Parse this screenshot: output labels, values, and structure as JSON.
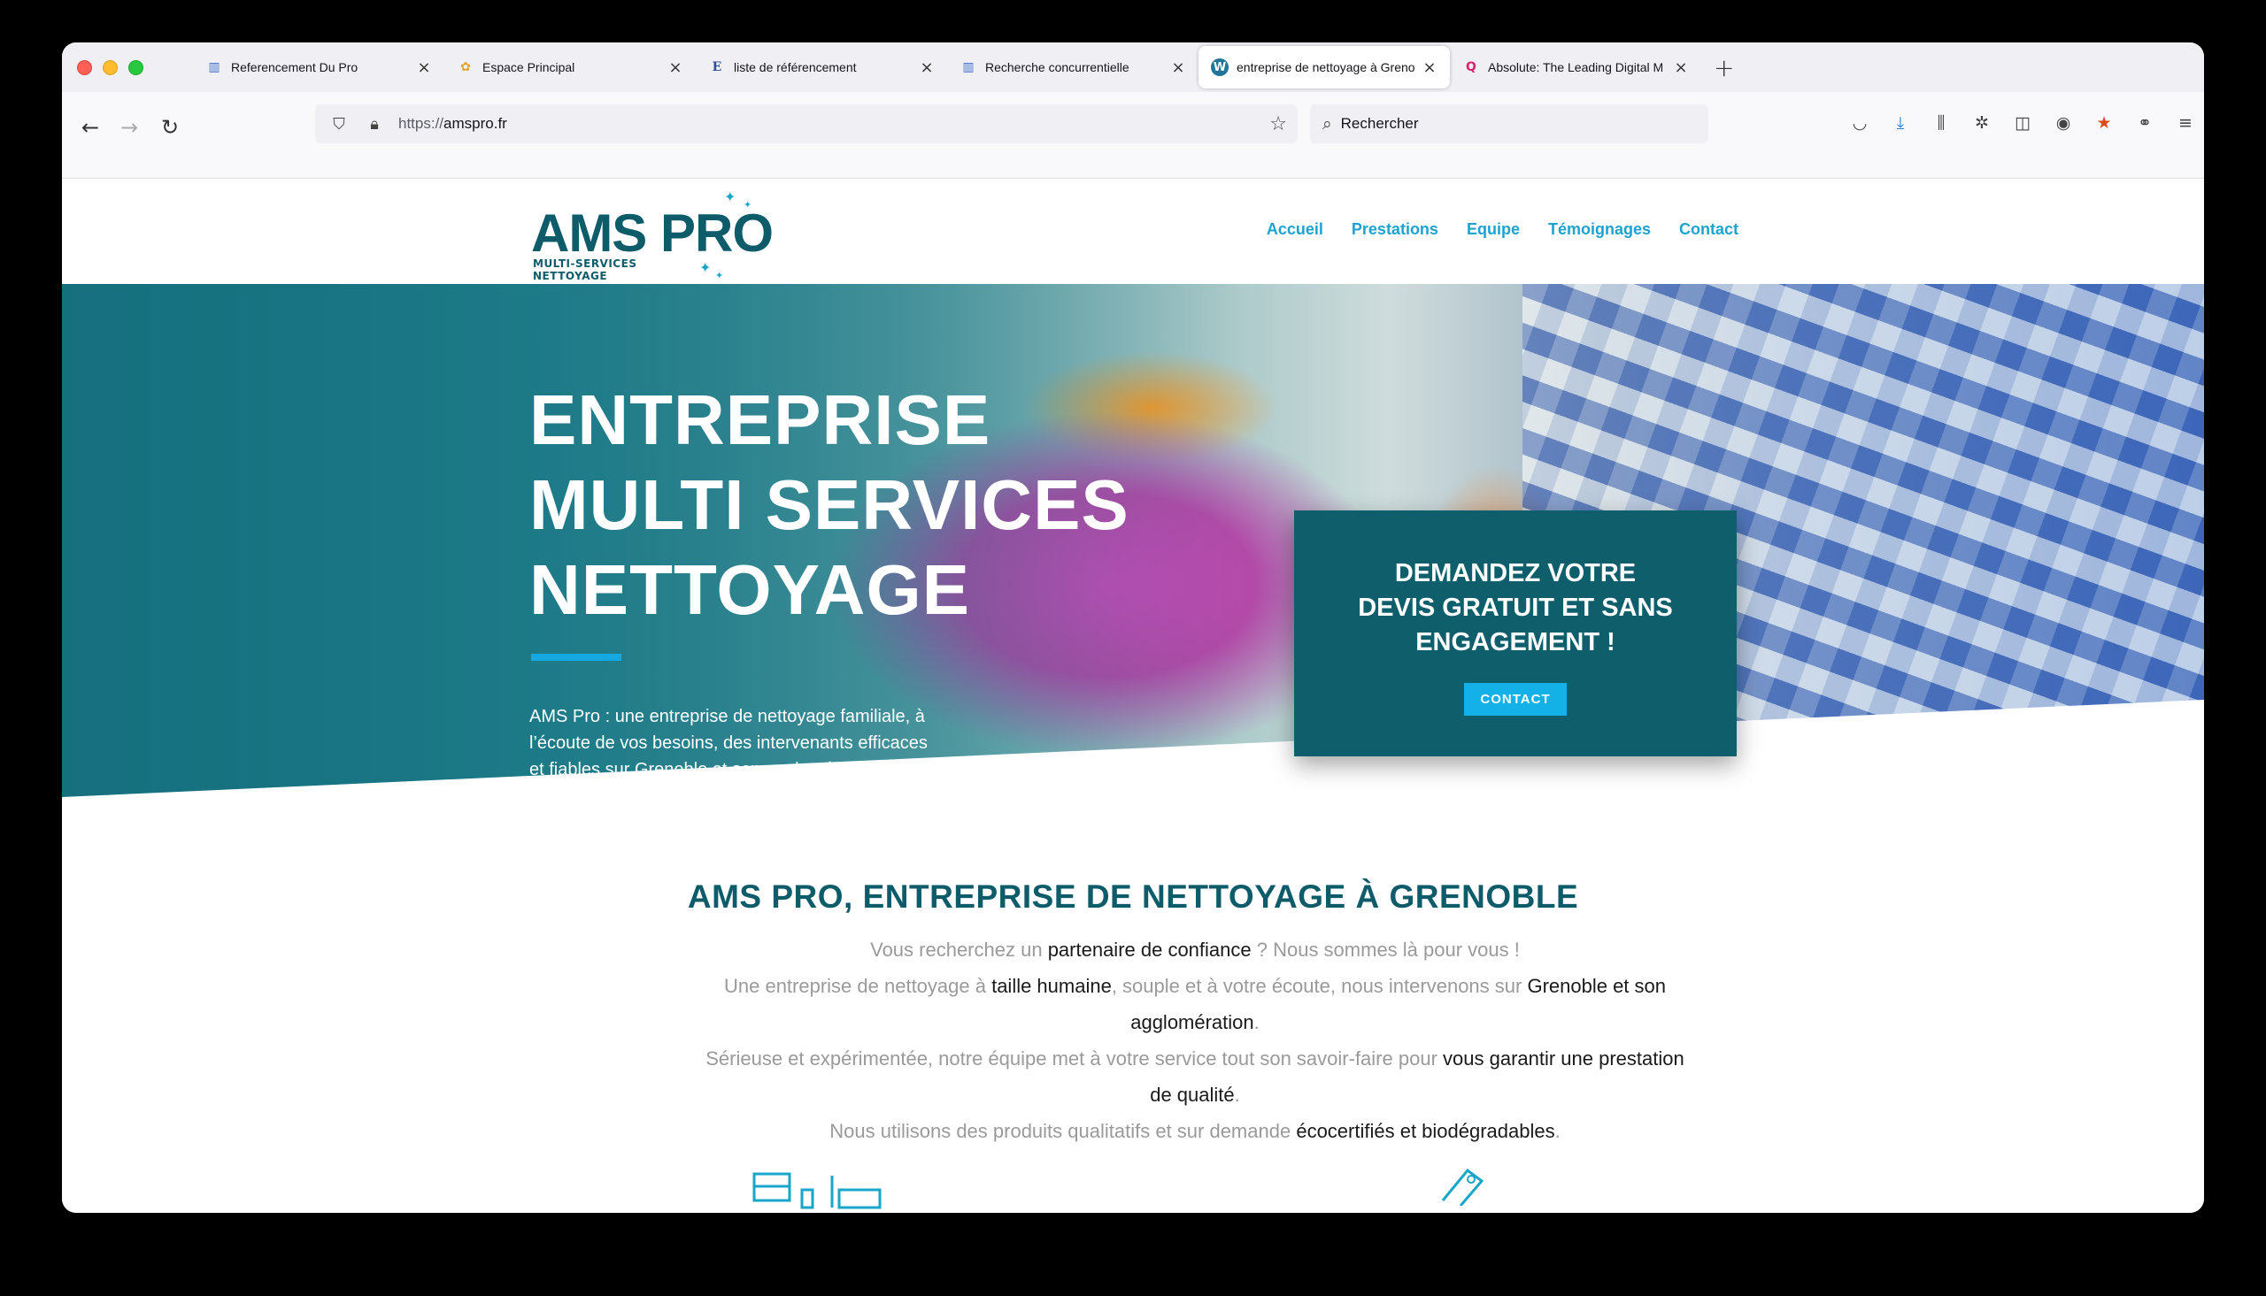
{
  "browser": {
    "tabs": [
      {
        "title": "Referencement Du Pro",
        "favicon": "chart-icon",
        "active": false
      },
      {
        "title": "Espace Principal",
        "favicon": "colorful-app-icon",
        "active": false
      },
      {
        "title": "liste de référencement",
        "favicon": "e-letter-icon",
        "active": false
      },
      {
        "title": "Recherche concurrentielle",
        "favicon": "chart-icon",
        "active": false
      },
      {
        "title": "entreprise de nettoyage à Greno",
        "favicon": "wordpress-icon",
        "active": true
      },
      {
        "title": "Absolute: The Leading Digital M",
        "favicon": "q-icon",
        "active": false
      }
    ],
    "url": {
      "scheme": "https://",
      "host": "amspro.fr"
    },
    "search_placeholder": "Rechercher"
  },
  "site": {
    "logo": {
      "main": "AMS PRO",
      "line1": "MULTI-SERVICES",
      "line2": "NETTOYAGE"
    },
    "nav": [
      "Accueil",
      "Prestations",
      "Equipe",
      "Témoignages",
      "Contact"
    ],
    "hero": {
      "title_lines": [
        "ENTREPRISE",
        "MULTI SERVICES",
        "NETTOYAGE"
      ],
      "intro_lines": [
        "AMS Pro : une entreprise de nettoyage familiale, à",
        "l’écoute de vos besoins, des intervenants efficaces",
        "et fiables sur Grenoble et son agglomération."
      ]
    },
    "quote_box": {
      "lines": [
        "DEMANDEZ VOTRE",
        "DEVIS GRATUIT ET SANS",
        "ENGAGEMENT !"
      ],
      "button": "CONTACT"
    },
    "section": {
      "title": "AMS PRO, ENTREPRISE DE NETTOYAGE À GRENOBLE",
      "p1": {
        "a": "Vous recherchez un ",
        "b": "partenaire de confiance",
        "c": " ? Nous sommes là pour vous !"
      },
      "p2": {
        "a": "Une entreprise de nettoyage à ",
        "b": "taille humaine",
        "c": ", souple et à votre écoute, nous intervenons sur ",
        "d": "Grenoble et son agglomération",
        "e": "."
      },
      "p3": {
        "a": "Sérieuse et expérimentée, notre équipe met à votre service tout son savoir-faire pour ",
        "b": "vous garantir une prestation de qualité",
        "c": "."
      },
      "p4": {
        "a": "Nous utilisons des produits qualitatifs et sur demande ",
        "b": "écocertifiés et biodégradables",
        "c": "."
      }
    }
  },
  "colors": {
    "brand_dark": "#0e5b6a",
    "brand_accent": "#1ea2cf",
    "button": "#14b0e8"
  }
}
